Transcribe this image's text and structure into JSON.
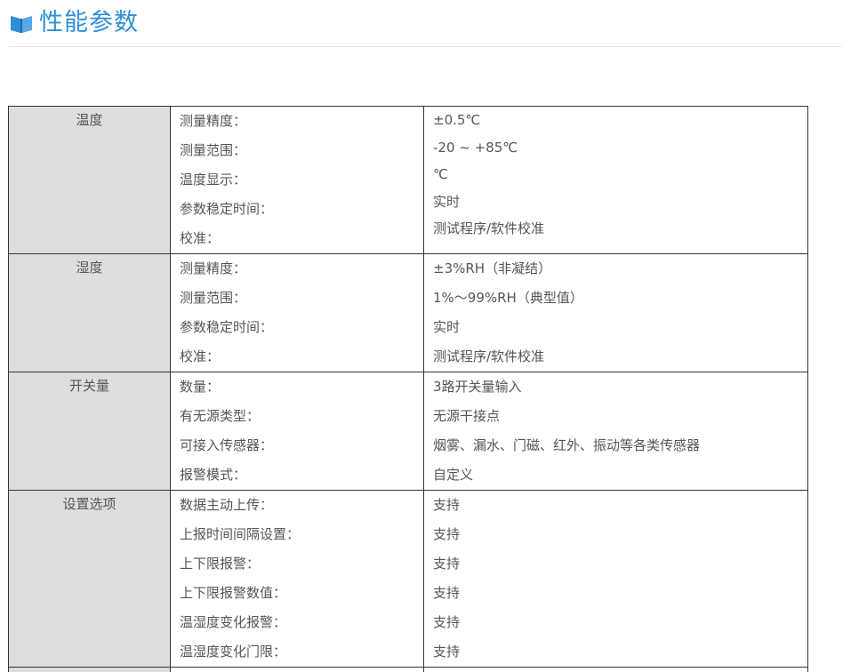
{
  "header": {
    "title": "性能参数",
    "icon": "book-icon",
    "accent": "#2f8fd8"
  },
  "sections": [
    {
      "category": "温度",
      "keys": [
        "测量精度：",
        "测量范围：",
        "温度显示：",
        "参数稳定时间：",
        "校准："
      ],
      "values": [
        "±0.5℃",
        "-20 ~ +85℃",
        "℃",
        "实时",
        "测试程序/软件校准"
      ]
    },
    {
      "category": "湿度",
      "keys": [
        "测量精度：",
        "测量范围：",
        "参数稳定时间：",
        "校准："
      ],
      "values": [
        "±3%RH（非凝结）",
        "1%～99%RH（典型值）",
        "实时",
        "测试程序/软件校准"
      ]
    },
    {
      "category": "开关量",
      "keys": [
        "数量：",
        "有无源类型：",
        "可接入传感器：",
        "报警模式："
      ],
      "values": [
        "3路开关量输入",
        "无源干接点",
        "烟雾、漏水、门磁、红外、振动等各类传感器",
        "自定义"
      ]
    },
    {
      "category": "设置选项",
      "keys": [
        "数据主动上传：",
        "上报时间间隔设置：",
        "上下限报警：",
        "上下限报警数值：",
        "温湿度变化报警：",
        "温湿度变化门限："
      ],
      "values": [
        "支持",
        "支持",
        "支持",
        "支持",
        "支持",
        "支持"
      ]
    }
  ]
}
